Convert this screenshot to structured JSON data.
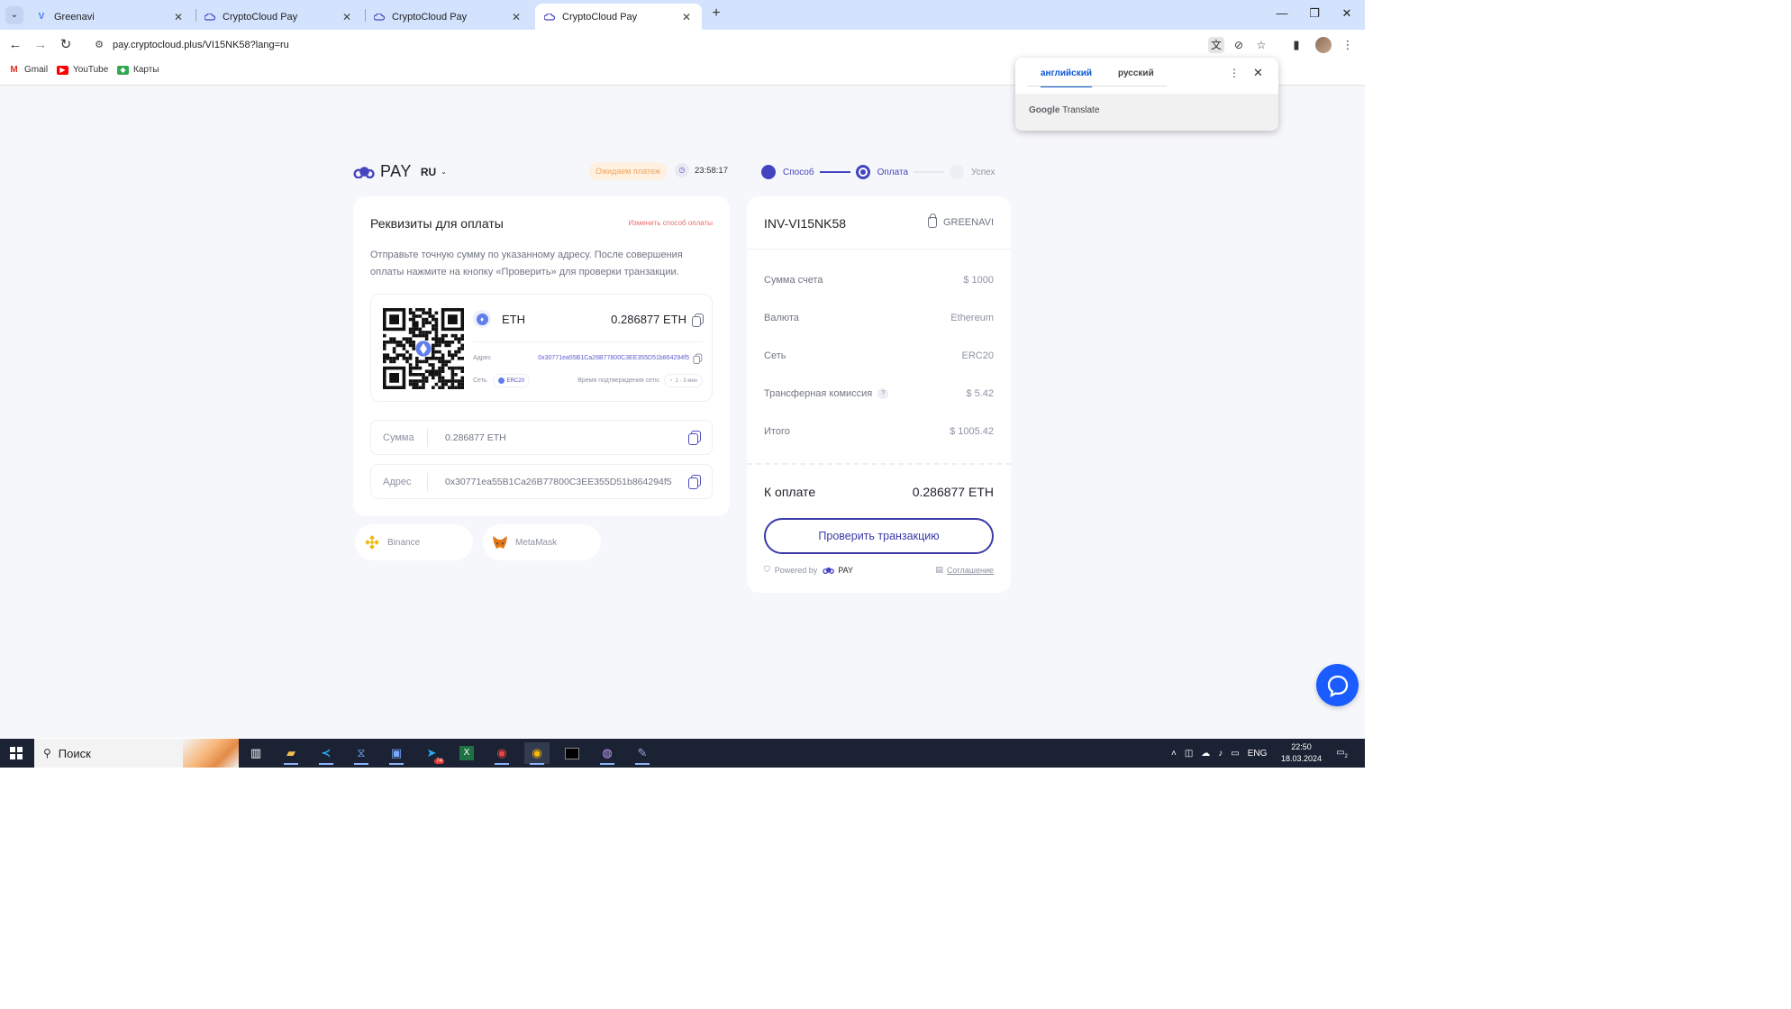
{
  "browser": {
    "tabs": [
      {
        "title": "Greenavi",
        "active": false
      },
      {
        "title": "CryptoCloud Pay",
        "active": false
      },
      {
        "title": "CryptoCloud Pay",
        "active": false
      },
      {
        "title": "CryptoCloud Pay",
        "active": true
      }
    ],
    "url": "pay.cryptocloud.plus/VI15NK58?lang=ru",
    "bookmarks": [
      "Gmail",
      "YouTube",
      "Карты"
    ]
  },
  "translate_popup": {
    "tab_source": "английский",
    "tab_target": "русский",
    "footer_brand": "Google",
    "footer_product": "Translate"
  },
  "header": {
    "logo_text": "PAY",
    "lang": "RU",
    "status": "Ожидаем платеж",
    "timer": "23:58:17",
    "steps": [
      {
        "label": "Способ",
        "state": "done"
      },
      {
        "label": "Оплата",
        "state": "current"
      },
      {
        "label": "Успех",
        "state": "todo"
      }
    ]
  },
  "payment": {
    "title": "Реквизиты для оплаты",
    "change_method": "Изменить способ оплаты",
    "description": "Отправьте точную сумму по указанному адресу. После совершения оплаты нажмите на кнопку «Проверить» для проверки транзакции.",
    "coin": "ETH",
    "amount": "0.286877 ETH",
    "address_label": "Адрес",
    "address": "0x30771ea55B1Ca26B77800C3EE355D51b864294f5",
    "network_label": "Сеть",
    "network": "ERC20",
    "confirm_label": "Время подтверждения сети:",
    "confirm_time": "1 - 3 мин",
    "sum_field_label": "Сумма",
    "sum_field_value": "0.286877 ETH",
    "addr_field_label": "Адрес",
    "addr_field_value": "0x30771ea55B1Ca26B77800C3EE355D51b864294f5",
    "wallets": [
      "Binance",
      "MetaMask"
    ]
  },
  "invoice": {
    "id": "INV-VI15NK58",
    "shop": "GREENAVI",
    "rows": [
      {
        "label": "Сумма счета",
        "value": "$ 1000"
      },
      {
        "label": "Валюта",
        "value": "Ethereum"
      },
      {
        "label": "Сеть",
        "value": "ERC20"
      },
      {
        "label": "Трансферная комиссия",
        "value": "$ 5.42",
        "help": "?"
      },
      {
        "label": "Итого",
        "value": "$ 1005.42"
      }
    ],
    "to_pay_label": "К оплате",
    "to_pay_value": "0.286877 ETH",
    "check_button": "Проверить транзакцию",
    "powered_by": "Powered by",
    "powered_logo": "PAY",
    "agreement": "Соглашение"
  },
  "taskbar": {
    "search_placeholder": "Поиск",
    "lang": "ENG",
    "time": "22:50",
    "date": "18.03.2024",
    "telegram_badge": "74",
    "notifications": "2"
  },
  "colors": {
    "accent": "#4544c0",
    "page_bg": "#f6f7fa",
    "status_bg": "#fff1e2",
    "status_text": "#f3a35a",
    "change_link": "#ea6c6c",
    "chat": "#1a5cff",
    "tabstrip": "#d3e3fd",
    "taskbar": "#1b2233"
  }
}
